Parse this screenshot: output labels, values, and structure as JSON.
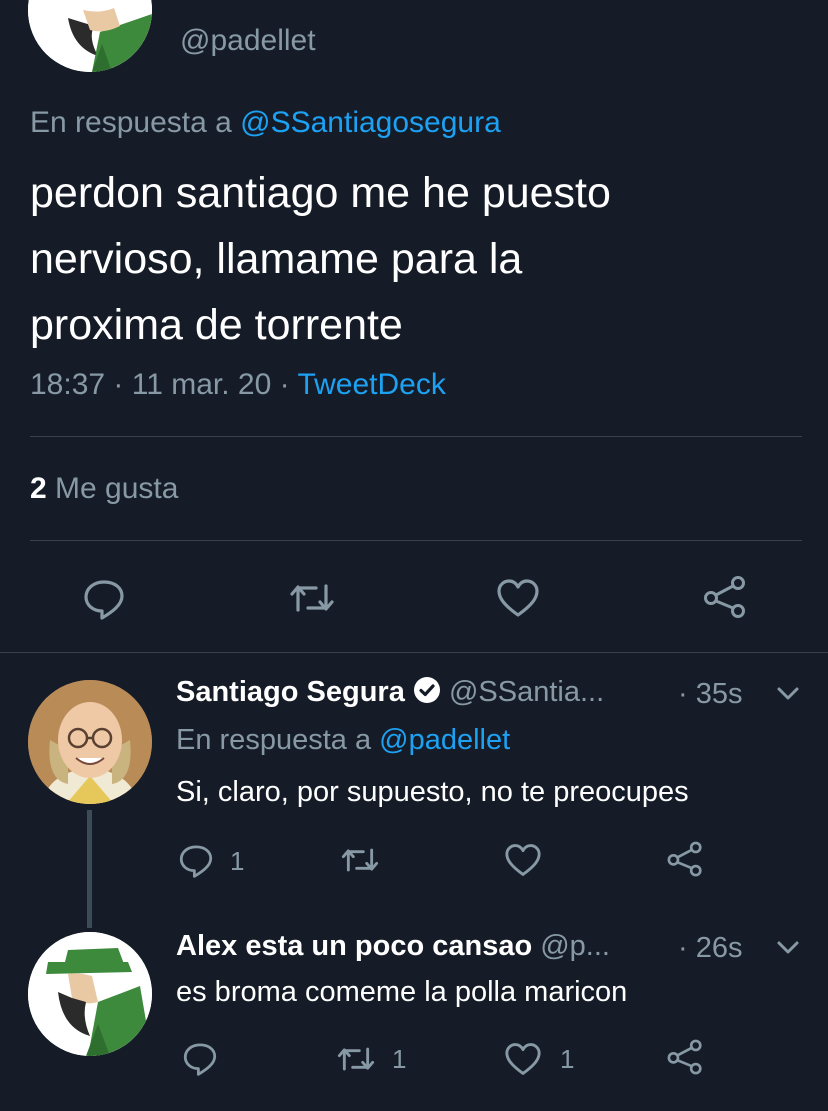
{
  "colors": {
    "background": "#151c27",
    "text": "#ffffff",
    "muted": "#8899a6",
    "link": "#1da1f2",
    "divider": "#38444d"
  },
  "main_tweet": {
    "handle": "@padellet",
    "reply_prefix": "En respuesta a",
    "reply_to": "@SSantiagosegura",
    "text_lines": [
      "perdon santiago me he puesto",
      "nervioso, llamame para la",
      "proxima de torrente"
    ],
    "time": "18:37",
    "sep1": "·",
    "date": "11 mar. 20",
    "sep2": "·",
    "source": "TweetDeck",
    "likes_count": "2",
    "likes_label": "Me gusta",
    "actions": [
      "reply-icon",
      "retweet-icon",
      "like-icon",
      "share-icon"
    ]
  },
  "replies": [
    {
      "name": "Santiago Segura",
      "verified": true,
      "handle": "@SSantia...",
      "time": "· 35s",
      "reply_prefix": "En respuesta a",
      "reply_to": "@padellet",
      "text": "Si, claro, por supuesto, no te preocupes",
      "reply_count": "1",
      "retweet_count": "",
      "like_count": ""
    },
    {
      "name": "Alex esta un poco cansao",
      "handle": "@p...",
      "time": "· 26s",
      "text": "es broma comeme la polla maricon",
      "reply_count": "",
      "retweet_count": "1",
      "like_count": "1"
    }
  ]
}
